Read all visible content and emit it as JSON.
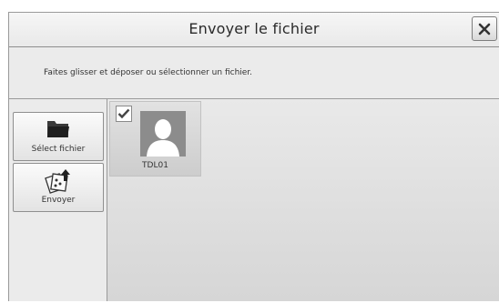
{
  "dialog": {
    "title": "Envoyer le fichier",
    "close_icon": "close-icon"
  },
  "instruction": "Faites glisser et déposer ou sélectionner un fichier.",
  "sidebar": {
    "items": [
      {
        "label": "Sélect fichier",
        "icon": "folder-icon"
      },
      {
        "label": "Envoyer",
        "icon": "send-files-icon"
      }
    ]
  },
  "files": [
    {
      "name": "TDL01",
      "checked": true,
      "icon": "user-avatar-icon"
    }
  ]
}
